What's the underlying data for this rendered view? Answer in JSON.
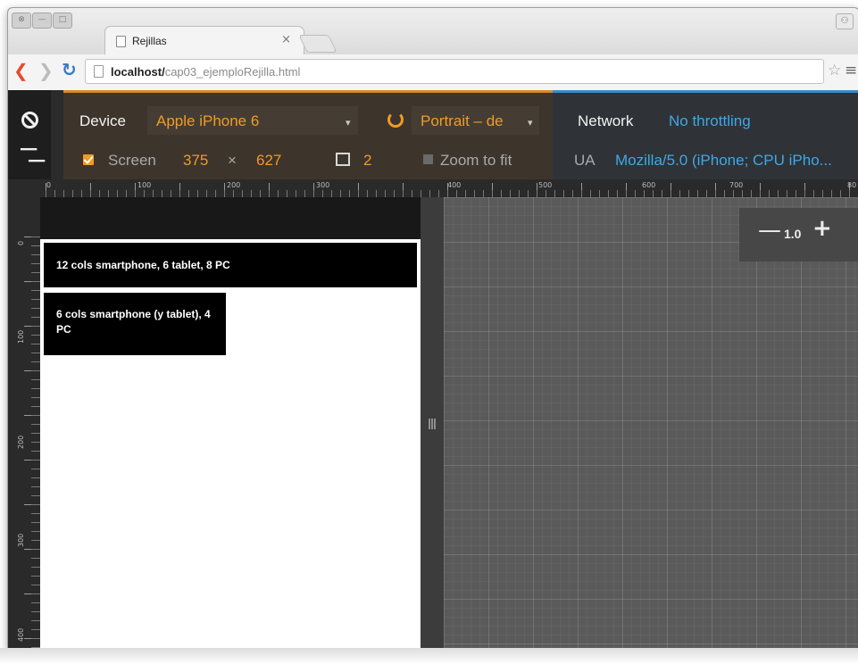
{
  "browser": {
    "tab_title": "Rejillas",
    "tab_close": "×",
    "url_host": "localhost/",
    "url_path": "cap03_ejemploRejilla.html"
  },
  "emulation": {
    "device_label": "Device",
    "device_value": "Apple iPhone 6",
    "orientation_value": "Portrait – de",
    "network_label": "Network",
    "network_value": "No throttling",
    "screen_label": "Screen",
    "screen_width": "375",
    "screen_times": "×",
    "screen_height": "627",
    "dpr_value": "2",
    "zoom_to_fit_label": "Zoom to fit",
    "ua_label": "UA",
    "ua_value": "Mozilla/5.0 (iPhone; CPU iPho..."
  },
  "ruler": {
    "h_labels": [
      "0",
      "100",
      "200",
      "300",
      "400",
      "500",
      "600",
      "700",
      "80"
    ],
    "v_labels": [
      "0",
      "100",
      "200",
      "300",
      "400"
    ]
  },
  "page": {
    "box1_text": "12 cols smartphone, 6 tablet, 8 PC",
    "box2_text": "6 cols smartphone (y tablet), 4 PC"
  },
  "zoom": {
    "minus": "—",
    "value": "1.0",
    "plus": "+"
  },
  "colors": {
    "accent_orange": "#ee9b28",
    "accent_blue": "#41a6e6",
    "back_arrow": "#e64b2e"
  }
}
